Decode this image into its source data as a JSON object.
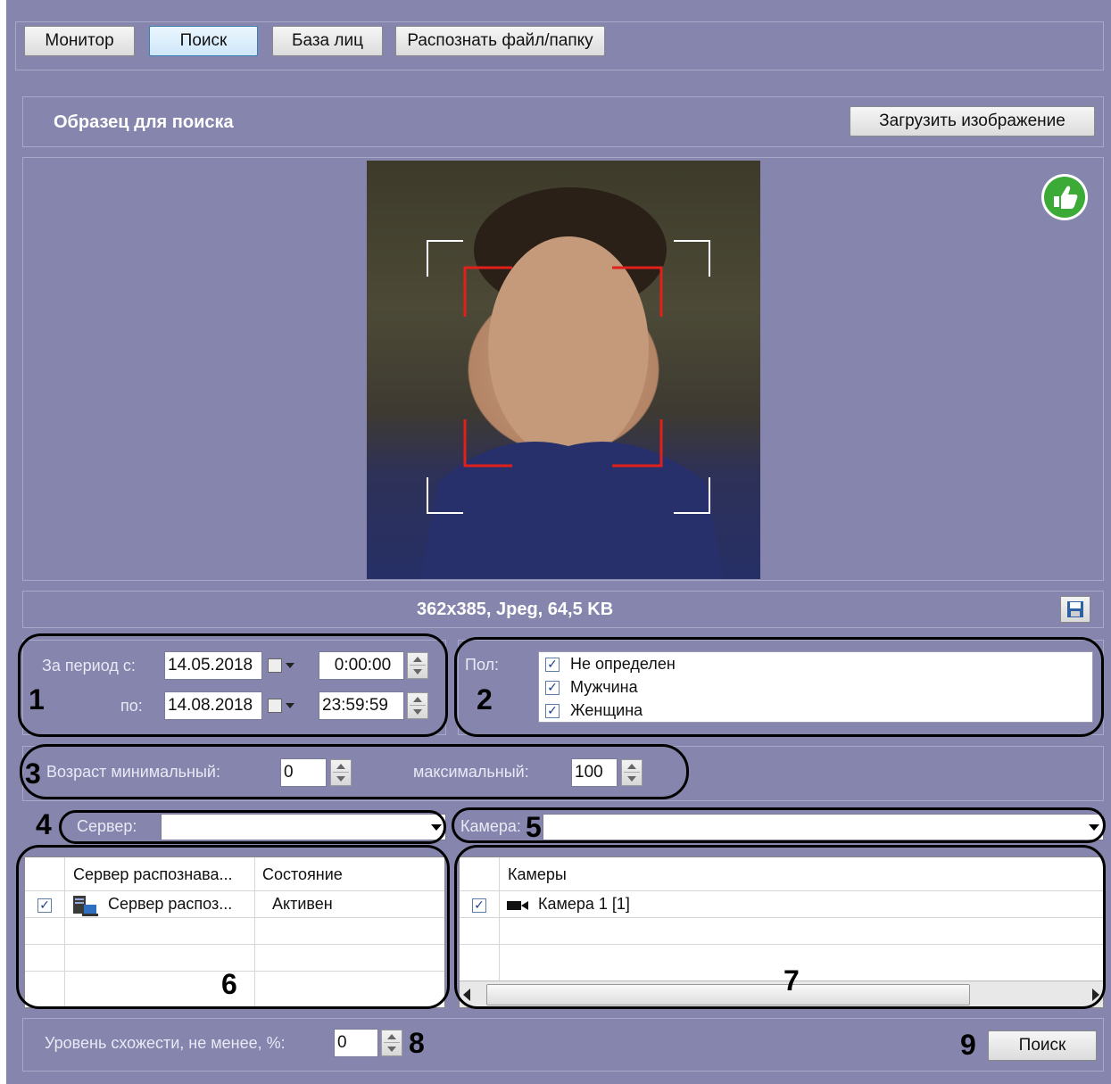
{
  "toolbar": {
    "monitor": "Монитор",
    "search": "Поиск",
    "faces": "База лиц",
    "recognize": "Распознать файл/папку"
  },
  "sample": {
    "title": "Образец для поиска",
    "upload_button": "Загрузить изображение",
    "image_info": "362x385, Jpeg, 64,5 KB"
  },
  "period": {
    "from_label": "За период с:",
    "to_label": "по:",
    "from_date": "14.05.2018",
    "from_time": "0:00:00",
    "to_date": "14.08.2018",
    "to_time": "23:59:59"
  },
  "gender": {
    "label": "Пол:",
    "options": [
      {
        "label": "Не определен",
        "checked": true
      },
      {
        "label": "Мужчина",
        "checked": true
      },
      {
        "label": "Женщина",
        "checked": true
      }
    ]
  },
  "age": {
    "min_label": "Возраст минимальный:",
    "min_value": "0",
    "max_label": "максимальный:",
    "max_value": "100"
  },
  "server": {
    "label": "Сервер:",
    "value": ""
  },
  "camera": {
    "label": "Камера:",
    "value": ""
  },
  "servers_table": {
    "columns": [
      "Сервер распознава...",
      "Состояние"
    ],
    "rows": [
      {
        "checked": true,
        "name": "Сервер распоз...",
        "status": "Активен"
      }
    ]
  },
  "cameras_table": {
    "columns": [
      "Камеры"
    ],
    "rows": [
      {
        "checked": true,
        "name": "Камера 1 [1]"
      }
    ]
  },
  "similarity": {
    "label": "Уровень схожести, не менее, %:",
    "value": "0"
  },
  "search_button": "Поиск",
  "callouts": [
    "1",
    "2",
    "3",
    "4",
    "5",
    "6",
    "7",
    "8",
    "9"
  ],
  "colors": {
    "panel": "#8585ad",
    "accept": "#3caa36"
  },
  "icons": {
    "accept": "thumbs-up-icon",
    "save": "save-icon",
    "calendar": "calendar-icon",
    "server": "server-icon",
    "camera": "camera-icon"
  }
}
